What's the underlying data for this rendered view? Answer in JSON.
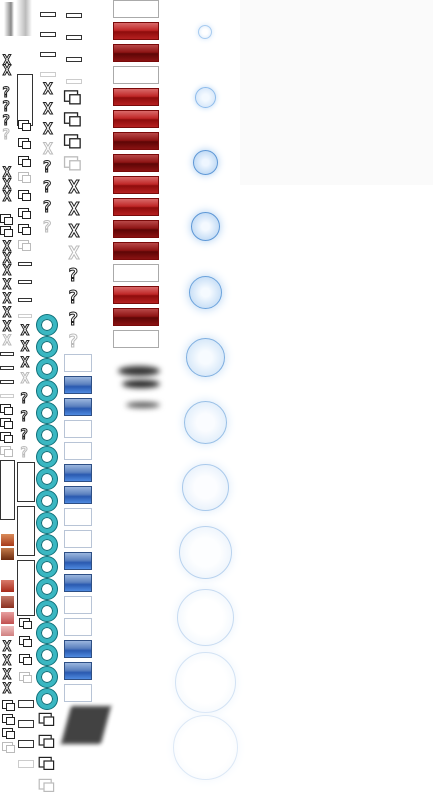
{
  "sheet": {
    "description_label": "",
    "colors": {
      "red": "#c02828",
      "dark_red": "#6e0808",
      "blue": "#3d6fc4",
      "cyan": "#3ab7c2",
      "glow": "#a7cbf0",
      "frame": "#333333"
    },
    "icons": [
      "close-icon",
      "help-icon",
      "restore-icon",
      "minimize-icon",
      "ring-icon",
      "glow-orb-icon"
    ]
  }
}
